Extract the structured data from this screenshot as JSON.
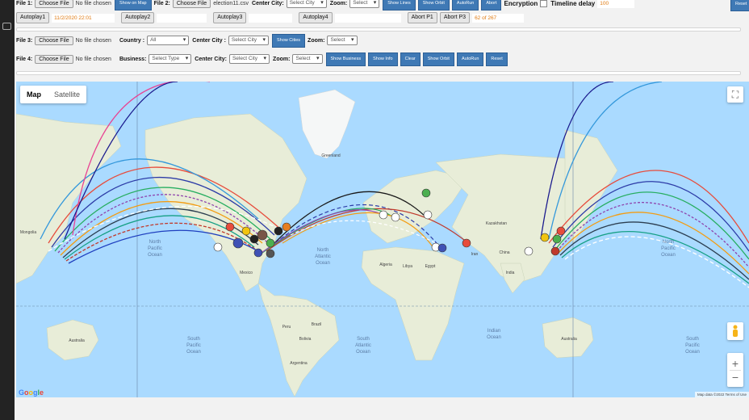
{
  "row1": {
    "file1_label": "File 1:",
    "choose_file": "Choose File",
    "no_file": "No file chosen",
    "show_on_map": "Show on Map",
    "file2_label": "File 2:",
    "file2_name": "election11.csv",
    "center_city_label": "Center City:",
    "select_city": "Select City",
    "zoom_label": "Zoom:",
    "select": "Select",
    "show_lines": "Show Lines",
    "show_orbit": "Show Orbit",
    "autorun": "AutoRun",
    "abort": "Abort",
    "encryption_label": "Encryption",
    "timeline_delay_label": "Timeline delay",
    "timeline_delay_value": "100",
    "reset": "Reset"
  },
  "row2": {
    "autoplay1": "Autoplay1",
    "autoplay1_value": "11/2/2020 22:01",
    "autoplay2": "Autoplay2",
    "autoplay3": "Autoplay3",
    "autoplay4": "Autoplay4",
    "abort_p1": "Abort P1",
    "abort_p3": "Abort P3",
    "counter": "62 of 267"
  },
  "row3": {
    "file3_label": "File 3:",
    "choose_file": "Choose File",
    "no_file": "No file chosen",
    "country_label": "Country :",
    "country_value": "All",
    "center_city_label": "Center City :",
    "select_city": "Select City",
    "show_cities": "Show Cities",
    "zoom_label": "Zoom:",
    "select": "Select"
  },
  "row4": {
    "file4_label": "File 4:",
    "choose_file": "Choose File",
    "no_file": "No file chosen",
    "business_label": "Business:",
    "select_type": "Select Type",
    "center_city_label": "Center City:",
    "select_city": "Select City",
    "zoom_label": "Zoom:",
    "select": "Select",
    "show_business": "Show Business",
    "show_info": "Show Info",
    "clear": "Clear",
    "show_orbit": "Show Orbit",
    "autorun": "AutoRun",
    "reset": "Reset"
  },
  "map": {
    "type_map": "Map",
    "type_satellite": "Satellite",
    "labels": {
      "greenland": "Greenland",
      "north_pacific_left": [
        "North",
        "Pacific",
        "Ocean"
      ],
      "north_atlantic": [
        "North",
        "Atlantic",
        "Ocean"
      ],
      "north_pacific_right": [
        "North",
        "Pacific",
        "Ocean"
      ],
      "south_pacific_left": [
        "South",
        "Pacific",
        "Ocean"
      ],
      "south_atlantic": [
        "South",
        "Atlantic",
        "Ocean"
      ],
      "indian_ocean": [
        "Indian",
        "Ocean"
      ],
      "south_pacific_right": [
        "South",
        "Pacific",
        "Ocean"
      ],
      "mongolia_left": "Mongolia",
      "kazakhstan": "Kazakhstan",
      "china": "China",
      "mexico": "Mexico",
      "brazil": "Brazil",
      "algeria": "Algeria",
      "libya": "Libya",
      "egypt": "Egypt",
      "australia_left": "Australia",
      "australia_right": "Australia",
      "india": "India",
      "iran": "Iran",
      "peru": "Peru",
      "bolivia": "Bolivia",
      "argentina": "Argentina"
    },
    "google": "Google",
    "attribution": "Map data ©2022   Terms of Use",
    "zoom_in": "+",
    "zoom_out": "−",
    "colors": {
      "ocean": "#aadaff",
      "land": "#e8edd8",
      "ice": "#f5f7f7",
      "desert": "#f1eee0"
    }
  }
}
